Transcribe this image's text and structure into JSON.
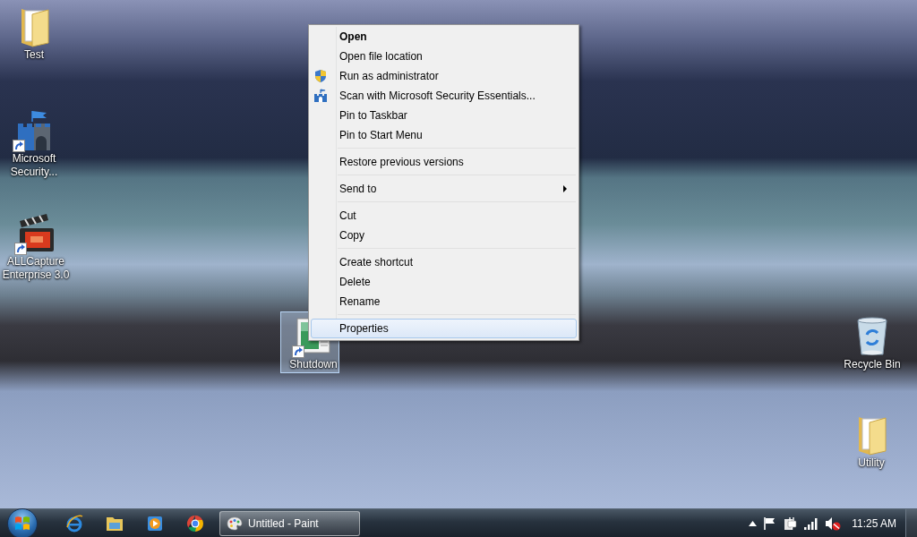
{
  "desktop_icons": [
    {
      "label": "Test",
      "kind": "folder",
      "shortcut": false,
      "selected": false
    },
    {
      "label": "Microsoft Security...",
      "kind": "castle",
      "shortcut": true,
      "selected": false
    },
    {
      "label": "ALLCapture Enterprise 3.0",
      "kind": "clapperboard",
      "shortcut": true,
      "selected": false
    },
    {
      "label": "Shutdown",
      "kind": "window",
      "shortcut": true,
      "selected": true
    },
    {
      "label": "Recycle Bin",
      "kind": "recycle_bin",
      "shortcut": false,
      "selected": false
    },
    {
      "label": "Utility",
      "kind": "folder",
      "shortcut": false,
      "selected": false
    }
  ],
  "context_menu": {
    "groups": [
      {
        "items": [
          {
            "label": "Open",
            "kind": "default",
            "selected": false
          },
          {
            "label": "Open file location",
            "kind": "command",
            "selected": false
          },
          {
            "label": "Run as administrator",
            "kind": "elevated",
            "selected": false
          },
          {
            "label": "Scan with Microsoft Security Essentials...",
            "kind": "scan",
            "selected": false
          },
          {
            "label": "Pin to Taskbar",
            "kind": "command",
            "selected": false
          },
          {
            "label": "Pin to Start Menu",
            "kind": "command",
            "selected": false
          }
        ]
      },
      {
        "items": [
          {
            "label": "Restore previous versions",
            "kind": "command",
            "selected": false
          }
        ]
      },
      {
        "items": [
          {
            "label": "Send to",
            "kind": "submenu",
            "selected": false
          }
        ]
      },
      {
        "items": [
          {
            "label": "Cut",
            "kind": "command",
            "selected": false
          },
          {
            "label": "Copy",
            "kind": "command",
            "selected": false
          }
        ]
      },
      {
        "items": [
          {
            "label": "Create shortcut",
            "kind": "command",
            "selected": false
          },
          {
            "label": "Delete",
            "kind": "command",
            "selected": false
          },
          {
            "label": "Rename",
            "kind": "command",
            "selected": false
          }
        ]
      },
      {
        "items": [
          {
            "label": "Properties",
            "kind": "command",
            "selected": true
          }
        ]
      }
    ]
  },
  "taskbar": {
    "windows": [
      {
        "label": "Untitled - Paint"
      }
    ],
    "volume_muted": true,
    "clock": "11:25 AM"
  }
}
